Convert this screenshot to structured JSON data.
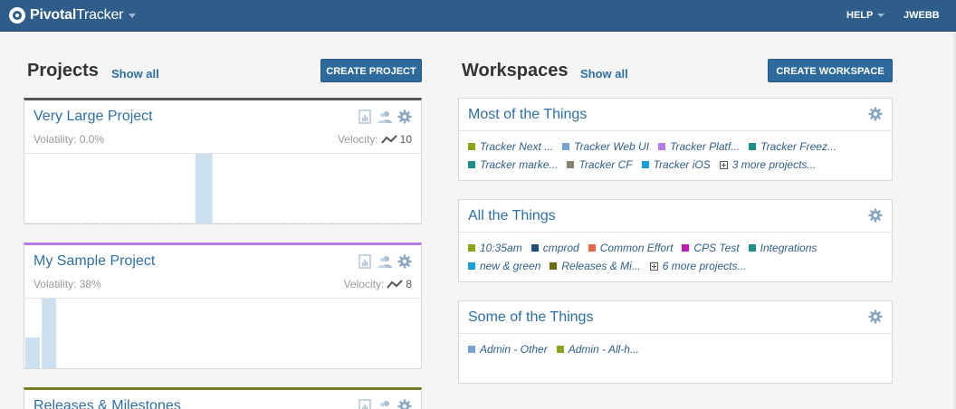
{
  "header": {
    "logo_bold": "Pivotal",
    "logo_rest": "Tracker",
    "help": "HELP",
    "user": "JWEBB"
  },
  "projects": {
    "title": "Projects",
    "show_all": "Show all",
    "create_label": "CREATE PROJECT",
    "items": [
      {
        "name": "Very Large Project",
        "volatility": "Volatility: 0.0%",
        "velocity_label": "Velocity:",
        "velocity": "10",
        "accent": "#555555",
        "chart": [
          0,
          0,
          0,
          0,
          0,
          0,
          0,
          0,
          0,
          100,
          0,
          0,
          0,
          0,
          0,
          0,
          0,
          0,
          0,
          0,
          0
        ]
      },
      {
        "name": "My Sample Project",
        "volatility": "Volatility: 38%",
        "velocity_label": "Velocity:",
        "velocity": "8",
        "accent": "#b87be6",
        "chart": [
          45,
          100
        ]
      },
      {
        "name": "Releases & Milestones",
        "accent": "#7a7a1f"
      }
    ]
  },
  "workspaces": {
    "title": "Workspaces",
    "show_all": "Show all",
    "create_label": "CREATE WORKSPACE",
    "items": [
      {
        "name": "Most of the Things",
        "rows": [
          [
            {
              "label": "Tracker Next ...",
              "color": "#8fa31a"
            },
            {
              "label": "Tracker Web UI",
              "color": "#7aa3d8"
            },
            {
              "label": "Tracker Platf...",
              "color": "#b87be6"
            },
            {
              "label": "Tracker Freez...",
              "color": "#1f8f8a"
            }
          ],
          [
            {
              "label": "Tracker marke...",
              "color": "#1f8f8a"
            },
            {
              "label": "Tracker CF",
              "color": "#8a8070"
            },
            {
              "label": "Tracker iOS",
              "color": "#1f9fe0"
            }
          ]
        ],
        "more": "3 more projects..."
      },
      {
        "name": "All the Things",
        "rows": [
          [
            {
              "label": "10:35am",
              "color": "#8fa31a"
            },
            {
              "label": "cmprod",
              "color": "#1f4f7a"
            },
            {
              "label": "Common Effort",
              "color": "#e8664a"
            },
            {
              "label": "CPS Test",
              "color": "#c21bb0"
            },
            {
              "label": "Integrations",
              "color": "#1f8f8a"
            }
          ],
          [
            {
              "label": "new & green",
              "color": "#1f9fe0"
            },
            {
              "label": "Releases & Mi...",
              "color": "#6b6b14"
            }
          ]
        ],
        "more": "6 more projects..."
      },
      {
        "name": "Some of the Things",
        "rows": [
          [
            {
              "label": "Admin - Other",
              "color": "#7aa3d8"
            },
            {
              "label": "Admin - All-h...",
              "color": "#8fa31a"
            }
          ]
        ],
        "more": ""
      }
    ]
  }
}
